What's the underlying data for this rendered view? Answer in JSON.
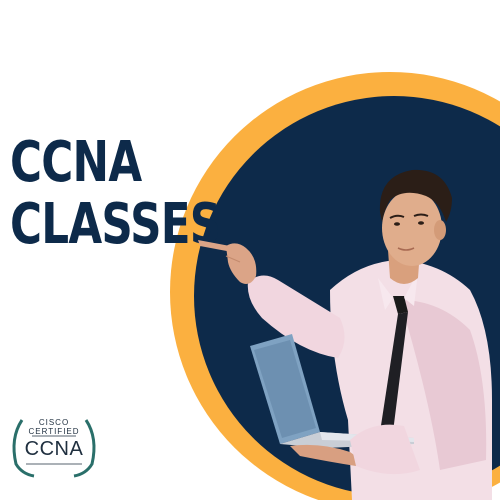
{
  "headline": {
    "line1": "CCNA",
    "line2": "CLASSES"
  },
  "badge": {
    "brand": "CISCO",
    "status": "CERTIFIED",
    "cert": "CCNA"
  },
  "colors": {
    "navy": "#0d2a4a",
    "orange": "#fbb040",
    "background": "#ffffff"
  }
}
